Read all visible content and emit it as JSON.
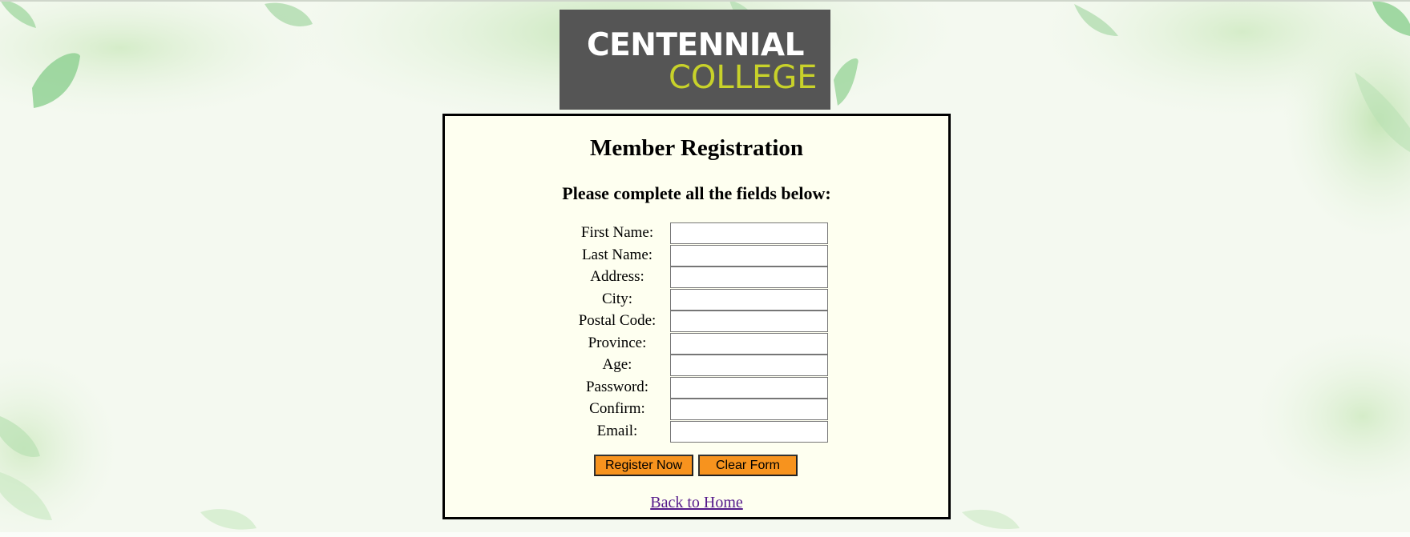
{
  "logo": {
    "line1": "CENTENNIAL",
    "line2": "COLLEGE"
  },
  "page": {
    "title": "Member Registration",
    "instructions": "Please complete all the fields below:"
  },
  "form": {
    "fields": [
      {
        "label": "First Name:",
        "value": ""
      },
      {
        "label": "Last Name:",
        "value": ""
      },
      {
        "label": "Address:",
        "value": ""
      },
      {
        "label": "City:",
        "value": ""
      },
      {
        "label": "Postal Code:",
        "value": ""
      },
      {
        "label": "Province:",
        "value": ""
      },
      {
        "label": "Age:",
        "value": ""
      },
      {
        "label": "Password:",
        "value": ""
      },
      {
        "label": "Confirm:",
        "value": ""
      },
      {
        "label": "Email:",
        "value": ""
      }
    ],
    "register_label": "Register Now",
    "clear_label": "Clear Form"
  },
  "footer": {
    "back_link": "Back to Home"
  },
  "colors": {
    "panel_background": "#fefff0",
    "button_background": "#f7931e",
    "logo_background": "#555555",
    "logo_accent": "#c8d22a",
    "link_visited": "#551a8b"
  }
}
